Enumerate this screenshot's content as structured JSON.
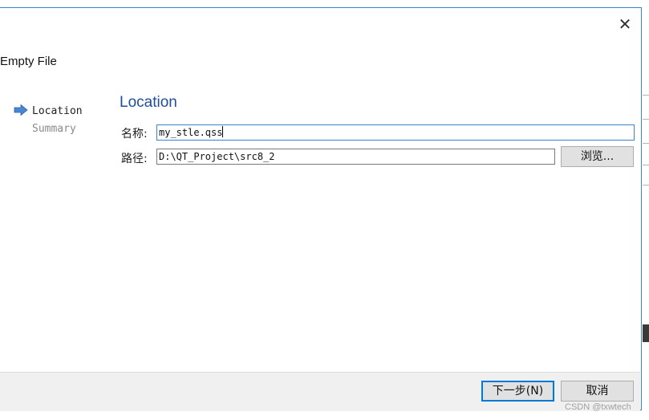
{
  "dialog": {
    "title": "Empty File",
    "close_glyph": "✕"
  },
  "steps": [
    {
      "label": "Location",
      "active": true
    },
    {
      "label": "Summary",
      "active": false
    }
  ],
  "page": {
    "heading": "Location",
    "name_label": "名称:",
    "name_value": "my_stle.qss",
    "path_label": "路径:",
    "path_value": "D:\\QT_Project\\src8_2",
    "browse_label": "浏览..."
  },
  "footer": {
    "next_label": "下一步(N)",
    "cancel_label": "取消"
  },
  "watermark": "CSDN @txwtech",
  "colors": {
    "accent": "#3c83c8",
    "heading": "#1f4e9c",
    "arrow": "#4a86d4"
  },
  "icons": {
    "step_marker": "right-arrow-icon",
    "close": "close-icon"
  }
}
